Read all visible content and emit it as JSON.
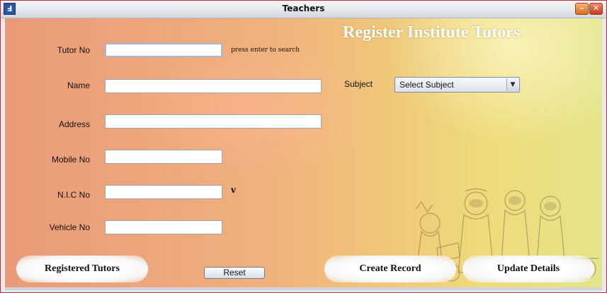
{
  "window": {
    "title": "Teachers",
    "app_icon_glyph": "Ⅎ",
    "minimize_glyph": "–",
    "close_glyph": "✕"
  },
  "header": {
    "title": "Register Institute Tutors"
  },
  "form": {
    "tutor_no": {
      "label": "Tutor No",
      "value": "",
      "hint": "press enter to search"
    },
    "name": {
      "label": "Name",
      "value": ""
    },
    "address": {
      "label": "Address",
      "value": ""
    },
    "mobile_no": {
      "label": "Mobile No",
      "value": ""
    },
    "nic_no": {
      "label": "N.I.C  No",
      "value": "",
      "suffix": "v"
    },
    "vehicle_no": {
      "label": "Vehicle No",
      "value": ""
    },
    "subject": {
      "label": "Subject",
      "selected": "Select Subject",
      "arrow_glyph": "▼"
    }
  },
  "buttons": {
    "registered_tutors": "Registered Tutors",
    "reset": "Reset",
    "create_record": "Create Record",
    "update_details": "Update Details"
  },
  "colors": {
    "window_border": "#c8282c",
    "background_left": "#e99a78",
    "background_right": "#e4e48a",
    "title_text": "#ffffff"
  }
}
